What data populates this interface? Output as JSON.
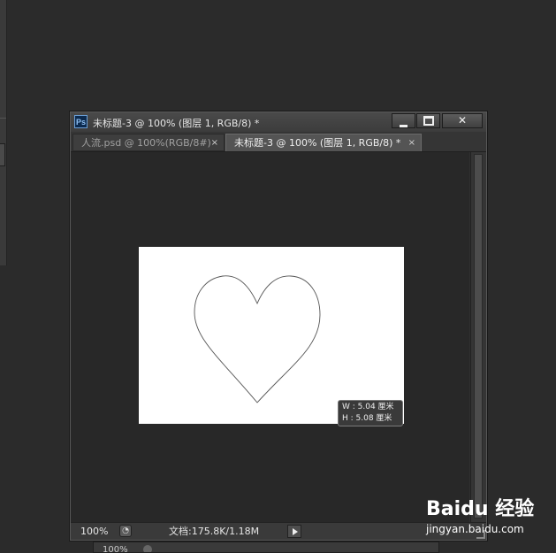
{
  "window": {
    "app_icon": "Ps",
    "title": "未标题-3 @ 100% (图层 1, RGB/8) *"
  },
  "tabs": [
    {
      "label": "人流.psd @ 100%(RGB/8#)",
      "close": "×"
    },
    {
      "label": "未标题-3 @ 100% (图层 1, RGB/8) *",
      "close": "×"
    }
  ],
  "controls": {
    "close_glyph": "✕"
  },
  "canvas": {
    "shape": "heart-icon",
    "shape_stroke_color": "#555555",
    "doc_background": "#ffffff",
    "tooltip": {
      "width": "W :  5.04 厘米",
      "height": "H :  5.08 厘米"
    }
  },
  "status": {
    "zoom": "100%",
    "doc_size": "文档:175.8K/1.18M"
  },
  "background_panel": {
    "zoom": "100%"
  },
  "watermark": {
    "brand": "Baidu 经验",
    "url": "jingyan.baidu.com"
  },
  "colors": {
    "workspace": "#2b2b2b",
    "window_chrome": "#3c3c3c",
    "active_tab": "#545454"
  }
}
